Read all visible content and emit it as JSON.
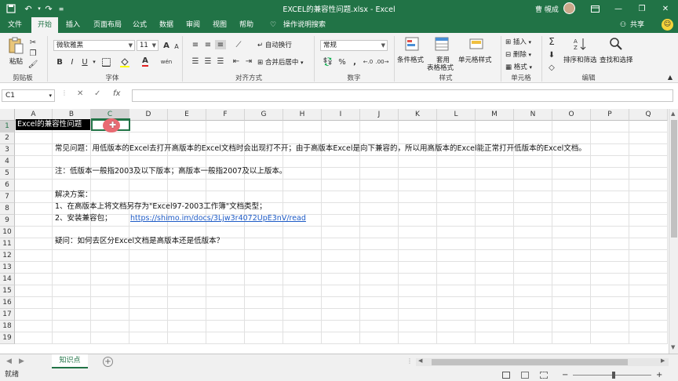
{
  "window": {
    "title": "EXCEL的兼容性问题.xlsx  -  Excel",
    "user": "曹 幌成",
    "minimize": "—",
    "restore": "❐",
    "close": "✕"
  },
  "tabs": [
    "文件",
    "开始",
    "插入",
    "页面布局",
    "公式",
    "数据",
    "审阅",
    "视图",
    "帮助"
  ],
  "active_tab": "开始",
  "tell_me": "操作说明搜索",
  "share": "共享",
  "ribbon": {
    "clipboard": {
      "paste": "粘贴",
      "label": "剪贴板"
    },
    "font": {
      "name": "微软雅黑",
      "size": "11",
      "label": "字体",
      "bold": "B",
      "italic": "I",
      "underline": "U",
      "grow": "A",
      "shrink": "A",
      "color_a": "A",
      "wen": "wén"
    },
    "alignment": {
      "wrap": "自动换行",
      "merge": "合并后居中",
      "label": "对齐方式"
    },
    "number": {
      "format": "常规",
      "percent": "%",
      "comma": ",",
      "label": "数字"
    },
    "styles": {
      "conditional": "条件格式",
      "table_l1": "套用",
      "table_l2": "表格格式",
      "cell": "单元格样式",
      "label": "样式"
    },
    "cells": {
      "insert": "插入",
      "delete": "删除",
      "format": "格式",
      "label": "单元格"
    },
    "editing": {
      "sort": "排序和筛选",
      "find": "查找和选择",
      "label": "编辑"
    }
  },
  "formula_bar": {
    "name_box": "C1",
    "cancel": "✕",
    "enter": "✓",
    "fx": "fx",
    "value": ""
  },
  "columns": [
    "A",
    "B",
    "C",
    "D",
    "E",
    "F",
    "G",
    "H",
    "I",
    "J",
    "K",
    "L",
    "M",
    "N",
    "O",
    "P",
    "Q"
  ],
  "selected_column": "C",
  "rows": [
    "1",
    "2",
    "3",
    "4",
    "5",
    "6",
    "7",
    "8",
    "9",
    "10",
    "11",
    "12",
    "13",
    "14",
    "15",
    "16",
    "17",
    "18",
    "19"
  ],
  "cells": {
    "a1": "Excel的兼容性问题",
    "b3": "常见问题：用低版本的Excel去打开高版本的Excel文档时会出现打不开；由于高版本Excel是向下兼容的，所以用高版本的Excel能正常打开低版本的Excel文档。",
    "b5": "注：低版本一般指2003及以下版本；高版本一般指2007及以上版本。",
    "b7": "解决方案：",
    "b8": "1、在高版本上将文档另存为\"Excel97-2003工作簿\"文档类型；",
    "b9": "2、安装兼容包；",
    "b9_link": "https://shimo.im/docs/3Ljw3r4072UpE3nV/read",
    "b11": "疑问：如何去区分Excel文档是高版本还是低版本？"
  },
  "sheet_tab": "知识点",
  "add_sheet": "+",
  "status": "就绪",
  "colors": {
    "excel_green": "#217346",
    "link": "#1e5bc6",
    "cursor": "#e96b73"
  }
}
